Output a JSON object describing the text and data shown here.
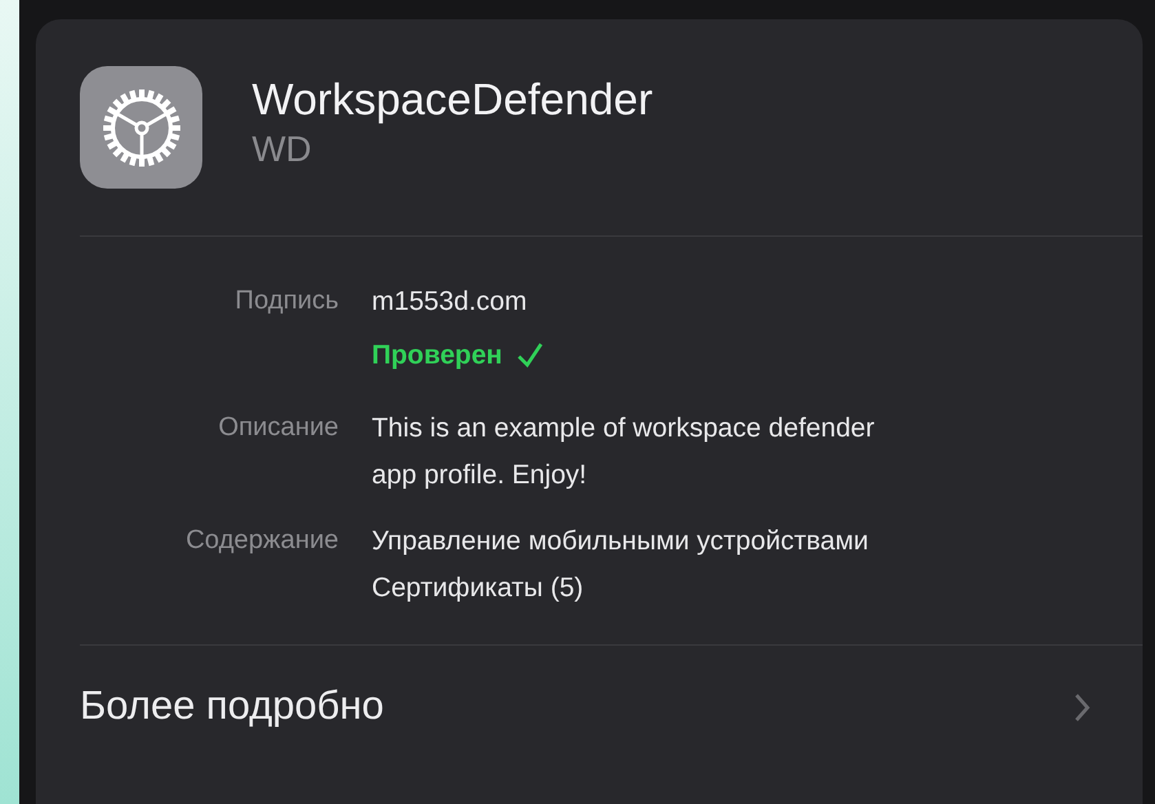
{
  "profile": {
    "name": "WorkspaceDefender",
    "short_name": "WD"
  },
  "details": [
    {
      "label": "Подпись",
      "lines": [
        "m1553d.com"
      ],
      "status": {
        "text": "Проверен",
        "verified": true
      }
    },
    {
      "label": "Описание",
      "lines": [
        "This is an example of workspace defender",
        "app profile. Enjoy!"
      ]
    },
    {
      "label": "Содержание",
      "lines": [
        "Управление мобильными устройствами",
        "Сертификаты (5)"
      ]
    }
  ],
  "more_link": {
    "label": "Более подробно"
  }
}
